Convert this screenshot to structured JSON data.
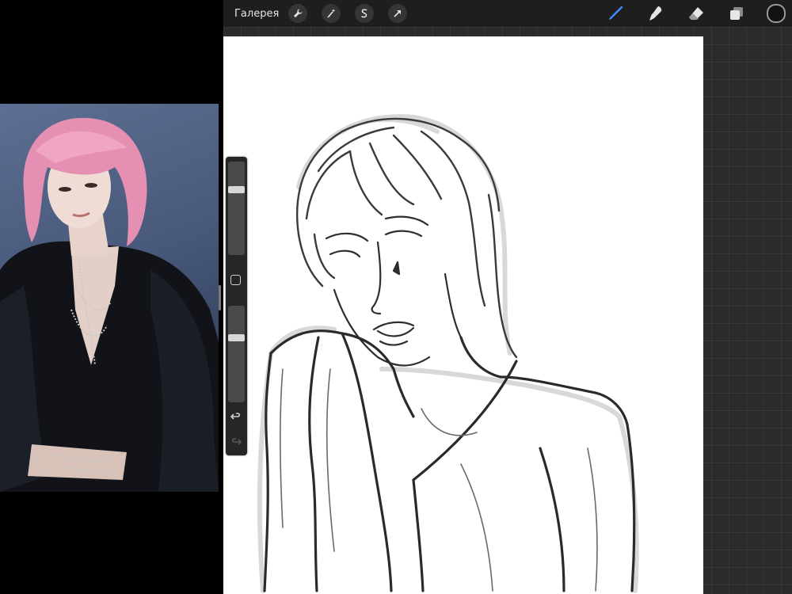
{
  "toolbar": {
    "gallery_label": "Галерея",
    "left_tools": [
      "wrench-icon",
      "magic-wand-icon",
      "selection-s-icon",
      "transform-arrow-icon"
    ],
    "right_tools": [
      "brush-icon",
      "smudge-icon",
      "eraser-icon",
      "layers-icon"
    ],
    "active_tool": "brush-icon",
    "accent_color": "#3f8cff",
    "current_color": "#111111"
  },
  "sidebar": {
    "brush_size_level": 0.72,
    "opacity_level": 0.68
  }
}
